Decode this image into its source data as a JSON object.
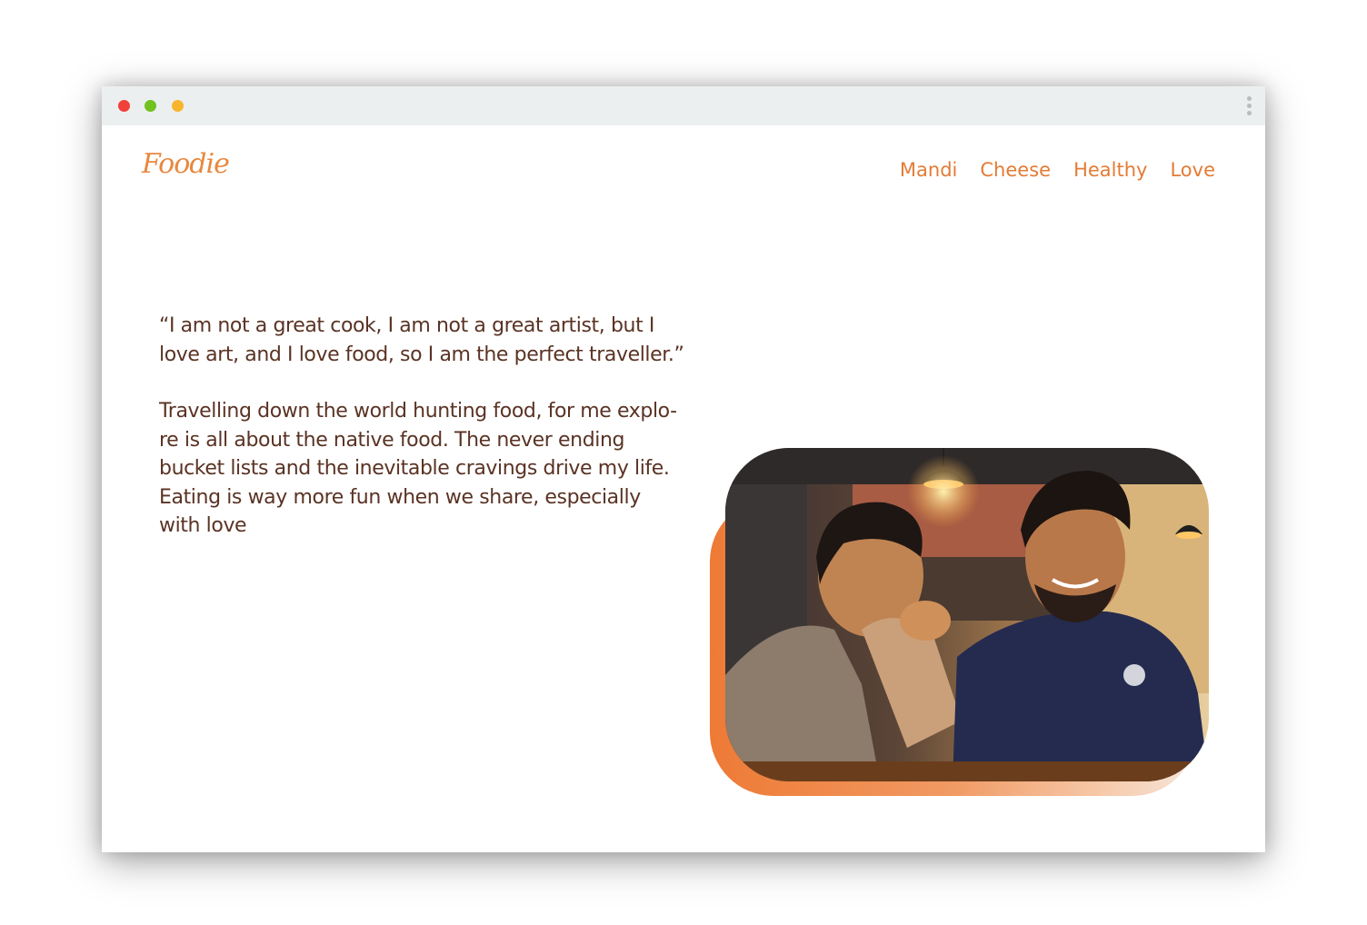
{
  "window": {
    "controls": [
      "close",
      "minimize",
      "maximize"
    ],
    "menu_icon": "kebab-menu-icon"
  },
  "brand": {
    "logo_text": "Foodie"
  },
  "nav": {
    "items": [
      "Mandi",
      "Cheese",
      "Healthy",
      "Love"
    ]
  },
  "main": {
    "quote_line1": "“I am not a great cook, I am not a great artist, but I",
    "quote_line2": "love art, and I love food, so I am the perfect traveller.”",
    "para_line1": "Travelling down the world hunting food, for me explo-",
    "para_line2": "re is all about  the native food. The never ending",
    "para_line3": "bucket lists and the inevitable cravings drive my life.",
    "para_line4": "Eating is way more fun when we share, especially",
    "para_line5": "with love"
  },
  "colors": {
    "accent": "#e47b35",
    "text": "#5a3324",
    "titlebar": "#eceff0"
  }
}
